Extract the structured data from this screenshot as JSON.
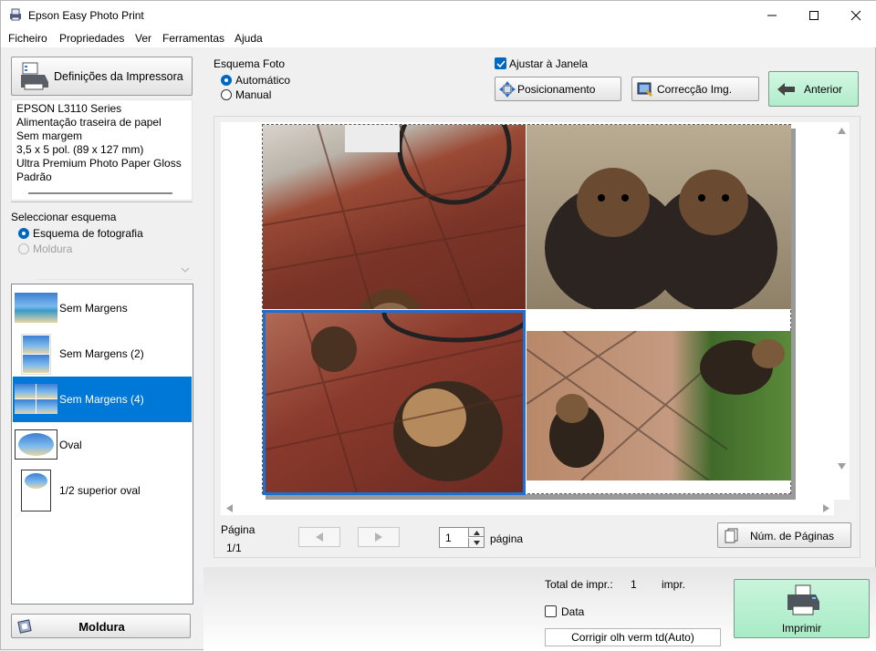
{
  "window": {
    "title": "Epson Easy Photo Print"
  },
  "menu": [
    "Ficheiro",
    "Propriedades",
    "Ver",
    "Ferramentas",
    "Ajuda"
  ],
  "sidebar": {
    "printer_button": "Definições da Impressora",
    "printer_info": [
      "EPSON L3110 Series",
      "Alimentação traseira de papel",
      "Sem margem",
      "3,5 x 5 pol. (89 x 127 mm)",
      "Ultra Premium Photo Paper Gloss",
      "Padrão"
    ],
    "select_layout_label": "Seleccionar esquema",
    "layout_options": [
      {
        "label": "Esquema de fotografia",
        "selected": true,
        "enabled": true
      },
      {
        "label": "Moldura",
        "selected": false,
        "enabled": false
      }
    ],
    "layouts": [
      {
        "label": "Sem Margens",
        "selected": false
      },
      {
        "label": "Sem Margens (2)",
        "selected": false
      },
      {
        "label": "Sem Margens (4)",
        "selected": true
      },
      {
        "label": "Oval",
        "selected": false
      },
      {
        "label": "1/2 superior oval",
        "selected": false
      }
    ],
    "moldura_button": "Moldura"
  },
  "toolbar": {
    "photo_layout_label": "Esquema Foto",
    "automatic": "Automático",
    "manual": "Manual",
    "automatic_selected": true,
    "fit_window": "Ajustar à Janela",
    "fit_window_checked": true,
    "positioning": "Posicionamento",
    "image_correction": "Correcção Img.",
    "previous": "Anterior"
  },
  "pager": {
    "page_label": "Página",
    "page_value": "1/1",
    "page_input": "1",
    "page_suffix": "página",
    "num_pages_button": "Núm. de Páginas"
  },
  "footer": {
    "total_label": "Total de impr.:",
    "total_value": "1",
    "total_unit": "impr.",
    "date_label": "Data",
    "date_checked": false,
    "red_eye_button": "Corrigir olh verm td(Auto)",
    "print_button": "Imprimir"
  },
  "colors": {
    "accent": "#0078d7",
    "print_button": "#b8f0d0",
    "previous_button": "#b6efd0"
  }
}
